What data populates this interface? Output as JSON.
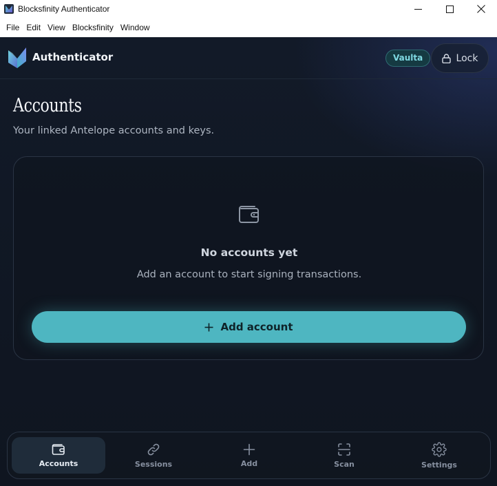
{
  "window": {
    "title": "Blocksfinity Authenticator"
  },
  "menu": [
    "File",
    "Edit",
    "View",
    "Blocksfinity",
    "Window"
  ],
  "header": {
    "brand": "Authenticator",
    "vault_badge": "Vaulta",
    "lock_label": "Lock"
  },
  "page": {
    "title": "Accounts",
    "subtitle": "Your linked Antelope accounts and keys."
  },
  "empty_state": {
    "title": "No accounts yet",
    "description": "Add an account to start signing transactions.",
    "add_button_label": "Add account"
  },
  "nav": {
    "items": [
      {
        "label": "Accounts",
        "icon": "wallet-icon",
        "active": true
      },
      {
        "label": "Sessions",
        "icon": "link-icon",
        "active": false
      },
      {
        "label": "Add",
        "icon": "plus-icon",
        "active": false
      },
      {
        "label": "Scan",
        "icon": "scan-icon",
        "active": false
      },
      {
        "label": "Settings",
        "icon": "gear-icon",
        "active": false
      }
    ]
  },
  "colors": {
    "accent": "#4eb6c1",
    "background": "#0f1622",
    "badge_text": "#7fd9e2"
  }
}
